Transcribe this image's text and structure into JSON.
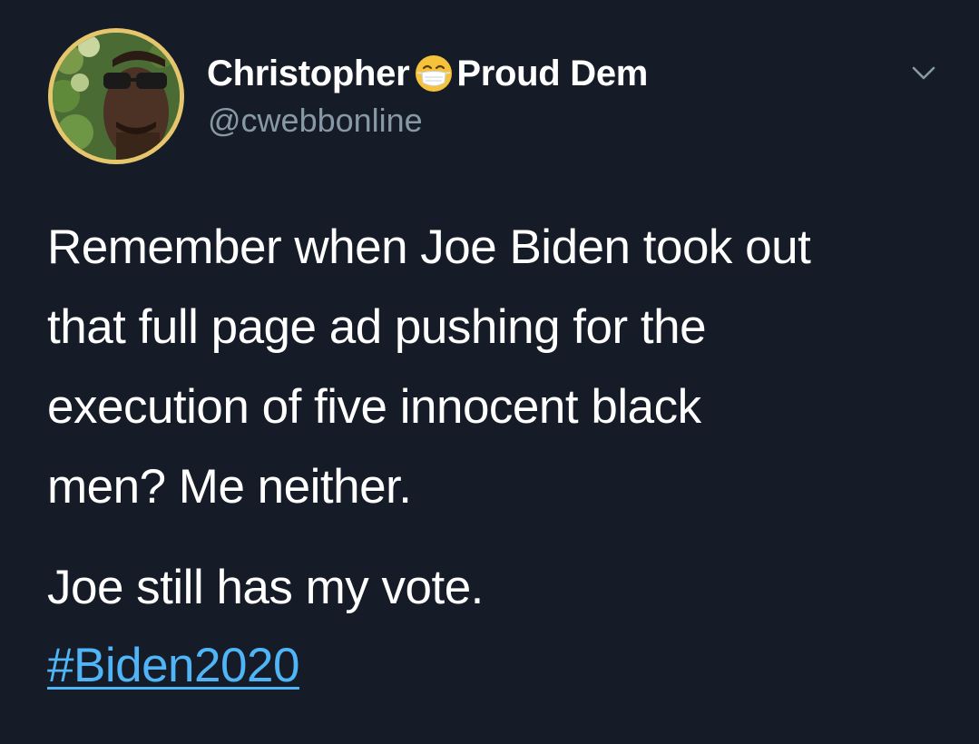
{
  "tweet": {
    "author": {
      "name_part1": "Christopher",
      "emoji_icon": "face-with-medical-mask-icon",
      "name_part2": "Proud Dem",
      "handle": "@cwebbonline"
    },
    "menu_icon": "chevron-down-icon",
    "text_lines": [
      "Remember when Joe Biden took out",
      "that full page ad pushing for the",
      "execution of five innocent black",
      "men? Me neither."
    ],
    "text_line2": "Joe still has my vote.",
    "hashtag": "#Biden2020"
  },
  "colors": {
    "background": "#151c27",
    "text": "#ffffff",
    "handle": "#8899a6",
    "hashtag": "#50b5f7",
    "avatar_border": "#e5c66c"
  }
}
